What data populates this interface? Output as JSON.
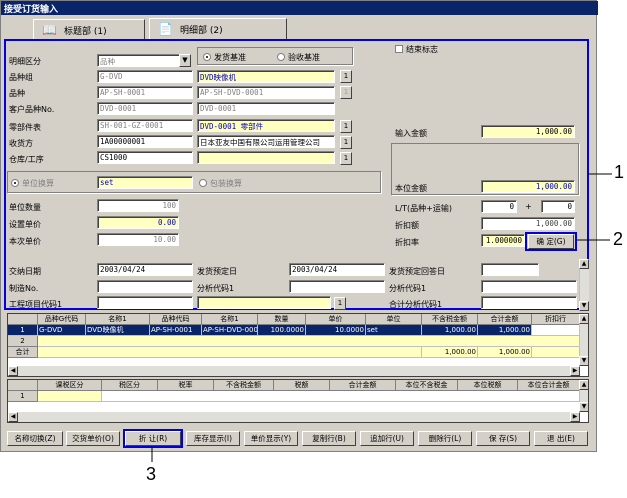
{
  "window": {
    "title": "接受订货输入"
  },
  "tabs": [
    {
      "label": "标题部 (1)"
    },
    {
      "label": "明细部 (2)"
    }
  ],
  "form": {
    "mingxi_label": "明细区分",
    "mingxi_value": "品种",
    "radio_ship": "发货基准",
    "radio_inspect": "验收基准",
    "end_flag": "结束标志",
    "pinzhongzu_label": "品种组",
    "pinzhongzu_code": "G-DVD",
    "pinzhongzu_name": "DVD映像机",
    "pinzhong_label": "品种",
    "pinzhong_code": "AP-SH-0001",
    "pinzhong_name": "AP-SH-DVD-0001",
    "kehu_label": "客户品种No.",
    "kehu_code": "DVD-0001",
    "kehu_name": "DVD-0001",
    "lingbu_label": "零部件表",
    "lingbu_code": "SH-001-GZ-0001",
    "lingbu_name": "DVD-0001 零部件",
    "shouhuo_label": "收货方",
    "shouhuo_code": "1A00000001",
    "shouhuo_name": "日本亚友中国有限公司运用管理公司",
    "cangku_label": "仓库/工序",
    "cangku_code": "CS1000",
    "cangku_name": "",
    "unit_conv": "单位换算",
    "unit_value": "set",
    "pack_conv": "包装换算",
    "danwei_qty_label": "单位数量",
    "danwei_qty": "100",
    "set_price_label": "设置单价",
    "set_price": "0.00",
    "this_price_label": "本次单价",
    "this_price": "10.00",
    "input_amount_label": "输入金额",
    "input_amount": "1,000.00",
    "local_amount_label": "本位金额",
    "local_amount": "1,000.00",
    "lt_label": "L/T(品种+运输)",
    "lt_a": "0",
    "lt_plus": "+",
    "lt_b": "0",
    "discount_amt_label": "折扣额",
    "discount_amt": "1,000.00",
    "discount_rate_label": "折扣率",
    "discount_rate": "1.000000",
    "confirm_btn": "确  定(G)",
    "delivery_label": "交纳日期",
    "delivery_date": "2003/04/24",
    "ship_plan_label": "发货预定日",
    "ship_plan_date": "2003/04/24",
    "ship_reply_label": "发货预定回答日",
    "ship_reply_date": "",
    "make_no_label": "制造No.",
    "analysis1_label": "分析代码1",
    "analysis2_label": "分析代码1",
    "project_label": "工程项目代码1",
    "total_analysis_label": "合计分析代码1"
  },
  "grid1": {
    "headers": [
      "",
      "品种G代码",
      "名称1",
      "品种代码",
      "名称1",
      "数量",
      "单价",
      "单位",
      "不含税金额",
      "合计金额",
      "折扣行"
    ],
    "rows": [
      [
        "1",
        "G-DVD",
        "DVD映像机",
        "AP-SH-0001",
        "AP-SH-DVD-000",
        "100.0000",
        "10.0000",
        "set",
        "1,000.00",
        "1,000.00",
        ""
      ],
      [
        "2",
        "",
        "",
        "",
        "",
        "",
        "",
        "",
        "",
        "",
        ""
      ],
      [
        "合计",
        "",
        "",
        "",
        "",
        "",
        "",
        "",
        "1,000.00",
        "1,000.00",
        ""
      ]
    ]
  },
  "grid2": {
    "headers": [
      "",
      "课税区分",
      "税区分",
      "税率",
      "不含税金额",
      "税额",
      "合计金额",
      "本位不含税金",
      "本位税额",
      "本位合计金额"
    ],
    "rows": [
      [
        "1",
        "",
        "",
        "",
        "",
        "",
        "",
        "",
        "",
        ""
      ]
    ]
  },
  "toolbar": [
    "名称切换(Z)",
    "交货单价(O)",
    "折  让(R)",
    "库存显示(I)",
    "单价显示(Y)",
    "复制行(B)",
    "追加行(U)",
    "删除行(L)",
    "保  存(S)",
    "退  出(E)"
  ],
  "callouts": [
    "1",
    "2",
    "3"
  ]
}
